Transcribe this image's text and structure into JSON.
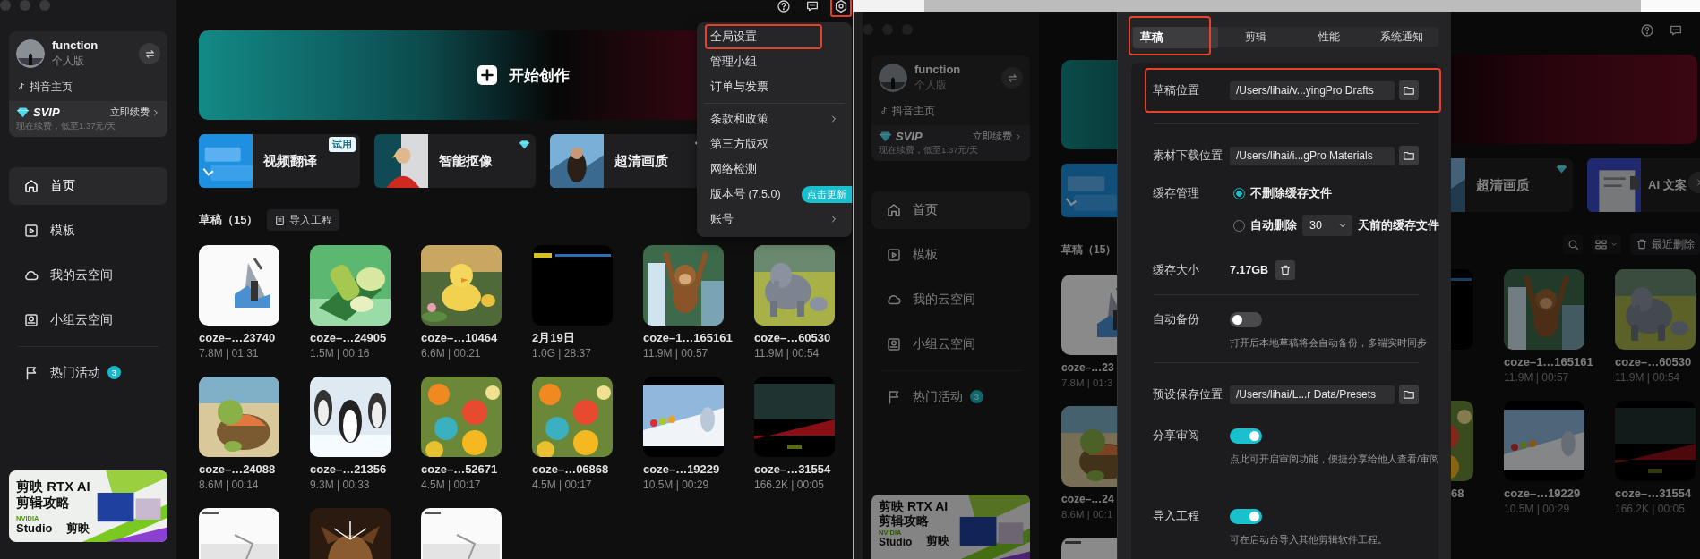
{
  "left_window": {
    "sidebar": {
      "account": {
        "name": "function",
        "plan": "个人版",
        "link": "抖音主页"
      },
      "vip": {
        "title": "SVIP",
        "action": "立即续费",
        "note": "现在续费，低至1.37元/天"
      },
      "nav": [
        [
          {
            "label": "首页",
            "selected": true
          },
          {
            "label": "模板",
            "selected": false
          },
          {
            "label": "我的云空间",
            "selected": false
          },
          {
            "label": "小组云空间",
            "selected": false
          }
        ],
        [
          {
            "label": "热门活动",
            "selected": false,
            "badge": "3"
          }
        ]
      ],
      "banner": {
        "lines": [
          "剪映 RTX AI",
          "剪辑攻略"
        ],
        "brands": [
          "NVIDIA",
          "Studio",
          "剪映"
        ]
      }
    },
    "toolbar": [
      {
        "kind": "help",
        "highlighted": false
      },
      {
        "kind": "feedback",
        "highlighted": false
      },
      {
        "kind": "settings",
        "highlighted": true
      }
    ],
    "hero": {
      "label": "开始创作"
    },
    "tools": [
      {
        "label": "视频翻译",
        "tag": "试用",
        "vip": false
      },
      {
        "label": "智能抠像",
        "vip": true
      },
      {
        "label": "超清画质",
        "vip": true
      }
    ],
    "drafts": {
      "title": "草稿（15）",
      "import_button": "导入工程",
      "items": [
        {
          "kind": "draft",
          "name": "coze–…23740",
          "meta": "7.8M | 01:31"
        },
        {
          "kind": "draft",
          "name": "coze–…24905",
          "meta": "1.5M | 00:16"
        },
        {
          "kind": "draft",
          "name": "coze–…10464",
          "meta": "6.6M | 00:21"
        },
        {
          "kind": "draft",
          "name": "2月19日",
          "meta": "1.0G | 28:37"
        },
        {
          "kind": "draft",
          "name": "coze–1…165161",
          "meta": "11.9M | 00:57"
        },
        {
          "kind": "draft",
          "name": "coze–…60530",
          "meta": "11.9M | 00:54"
        },
        {
          "kind": "draft",
          "name": "coze–…24088",
          "meta": "8.6M | 00:14"
        },
        {
          "kind": "draft",
          "name": "coze–…21356",
          "meta": "9.3M | 00:33"
        },
        {
          "kind": "draft",
          "name": "coze–…52671",
          "meta": "4.5M | 00:17"
        },
        {
          "kind": "draft",
          "name": "coze–…06868",
          "meta": "4.5M | 00:17"
        },
        {
          "kind": "draft",
          "name": "coze–…19229",
          "meta": "10.5M | 00:29"
        },
        {
          "kind": "draft",
          "name": "coze–…31554",
          "meta": "166.2K | 00:05"
        },
        {
          "kind": "picture"
        },
        {
          "kind": "picture"
        },
        {
          "kind": "picture"
        }
      ]
    },
    "menu": {
      "groups": [
        [
          {
            "label": "全局设置",
            "highlighted": true,
            "submenu": false
          },
          {
            "label": "管理小组",
            "highlighted": false,
            "submenu": false
          },
          {
            "label": "订单与发票",
            "highlighted": false,
            "submenu": false
          }
        ],
        [
          {
            "label": "条款和政策",
            "highlighted": false,
            "submenu": true
          },
          {
            "label": "第三方版权",
            "highlighted": false,
            "submenu": false
          },
          {
            "label": "网络检测",
            "highlighted": false,
            "submenu": false
          },
          {
            "label": "版本号 (7.5.0)",
            "highlighted": false,
            "submenu": false,
            "badge": "点击更新"
          },
          {
            "label": "账号",
            "highlighted": false,
            "submenu": true
          }
        ]
      ]
    }
  },
  "right_window": {
    "sidebar": {
      "account": {
        "name": "function",
        "plan": "个人版",
        "link": "抖音主页"
      },
      "vip": {
        "title": "SVIP",
        "action": "立即续费",
        "note": "现在续费，低至1.37元/天"
      },
      "nav": [
        [
          {
            "label": "首页",
            "selected": true
          },
          {
            "label": "模板",
            "selected": false
          },
          {
            "label": "我的云空间",
            "selected": false
          },
          {
            "label": "小组云空间",
            "selected": false
          }
        ],
        [
          {
            "label": "热门活动",
            "selected": false,
            "badge": "3"
          }
        ]
      ],
      "banner": {
        "lines": [
          "剪映 RTX AI",
          "剪辑攻略"
        ],
        "brands": [
          "NVIDIA",
          "Studio",
          "剪映"
        ]
      }
    },
    "drafts_strip": {
      "title": "草稿（15）",
      "items": [
        {
          "kind": "draft",
          "name": "coze–…23",
          "meta": "7.8M | 01:3"
        },
        {
          "kind": "draft",
          "name": "coze–…24",
          "meta": "8.6M | 00:1"
        },
        {
          "kind": "picture"
        }
      ]
    },
    "settings_dialog": {
      "tabs": [
        {
          "label": "草稿",
          "selected": true,
          "highlighted": true
        },
        {
          "label": "剪辑",
          "selected": false,
          "highlighted": false
        },
        {
          "label": "性能",
          "selected": false,
          "highlighted": false
        },
        {
          "label": "系统通知",
          "selected": false,
          "highlighted": false
        }
      ],
      "rows": [
        {
          "kind": "path",
          "label": "草稿位置",
          "value": "/Users/lihai/v...yingPro Drafts",
          "highlighted": true
        },
        {
          "kind": "divider"
        },
        {
          "kind": "path",
          "label": "素材下载位置",
          "value": "/Users/lihai/i...gPro Materials",
          "highlighted": false
        },
        {
          "kind": "cache",
          "label": "缓存管理",
          "options": [
            {
              "kind": "plain",
              "label": "不删除缓存文件",
              "selected": true
            },
            {
              "kind": "days",
              "label": "自动删除",
              "value": "30",
              "suffix": "天前的缓存文件",
              "selected": false
            }
          ]
        },
        {
          "kind": "size",
          "label": "缓存大小",
          "value": "7.17GB"
        },
        {
          "kind": "divider"
        },
        {
          "kind": "toggle",
          "label": "自动备份",
          "on": false,
          "hint": "打开后本地草稿将会自动备份，多端实时同步"
        },
        {
          "kind": "divider"
        },
        {
          "kind": "path",
          "label": "预设保存位置",
          "value": "/Users/lihai/L...r Data/Presets",
          "highlighted": false
        },
        {
          "kind": "toggle",
          "label": "分享审阅",
          "on": true,
          "hint": "点此可开启审阅功能，便捷分享给他人查看/审阅"
        },
        {
          "kind": "toggle",
          "label": "导入工程",
          "on": true,
          "hint": "可在启动台导入其他剪辑软件工程。"
        }
      ]
    },
    "main_right": {
      "toolbar": [
        {
          "kind": "help",
          "highlighted": false
        },
        {
          "kind": "feedback",
          "highlighted": false
        }
      ],
      "tools": [
        {
          "label": "超清画质",
          "vip": true
        },
        {
          "label": "AI 文案",
          "vip": false
        }
      ],
      "recent_deleted": "最近删除",
      "items": [
        {
          "kind": "picture"
        },
        {
          "kind": "draft",
          "name": "coze–1…165161",
          "meta": "11.9M | 00:57"
        },
        {
          "kind": "draft",
          "name": "coze–…60530",
          "meta": "11.9M | 00:54"
        },
        {
          "kind": "draft",
          "name": "68"
        },
        {
          "kind": "draft",
          "name": "coze–…19229",
          "meta": "10.5M | 00:29"
        },
        {
          "kind": "draft",
          "name": "coze–…31554",
          "meta": "166.2K | 00:05"
        }
      ]
    }
  }
}
